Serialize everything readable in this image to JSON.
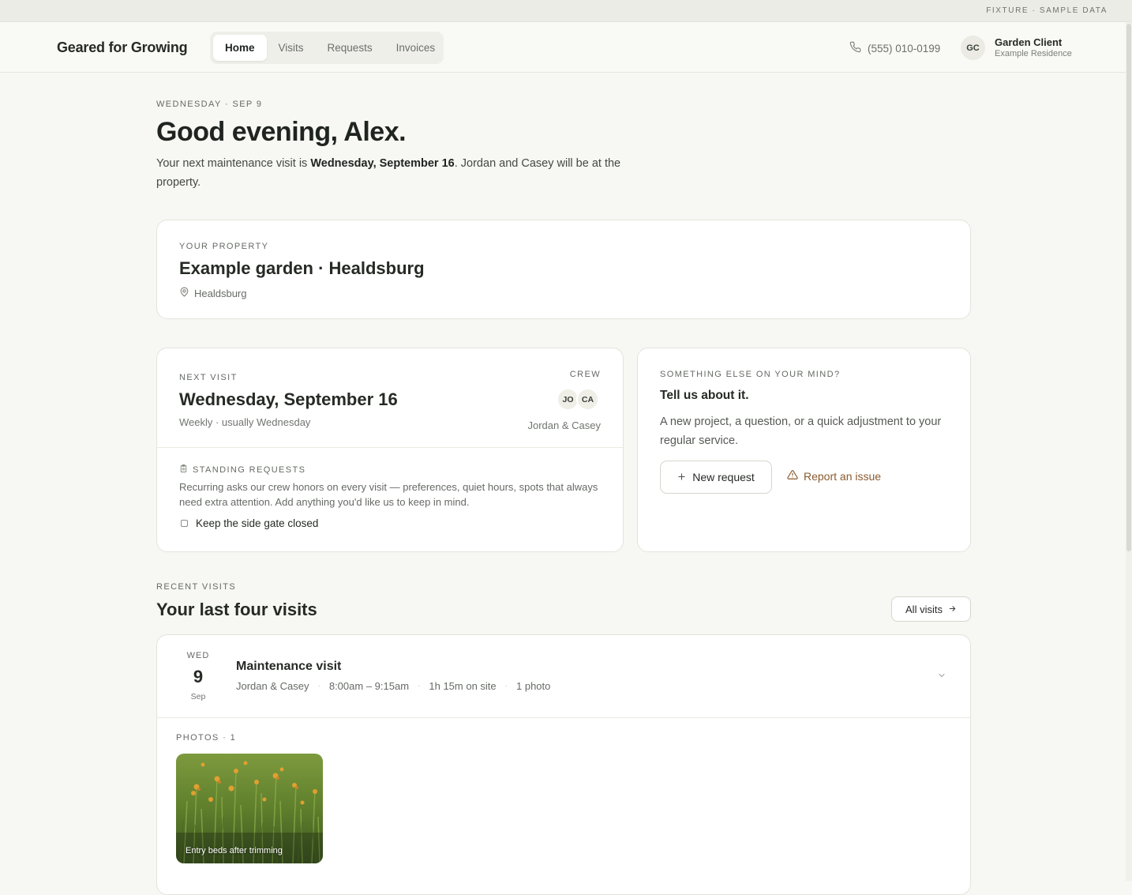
{
  "fixture_banner": "FIXTURE · SAMPLE DATA",
  "brand": "Geared for Growing",
  "nav": {
    "tabs": [
      {
        "label": "Home",
        "active": true
      },
      {
        "label": "Visits",
        "active": false
      },
      {
        "label": "Requests",
        "active": false
      },
      {
        "label": "Invoices",
        "active": false
      }
    ]
  },
  "header": {
    "phone": "(555) 010-0199",
    "phone_icon": "phone-icon",
    "avatar_initials": "GC",
    "user_name": "Garden Client",
    "user_sub": "Example Residence"
  },
  "greeting": {
    "date": "WEDNESDAY · SEP 9",
    "title": "Good evening, Alex.",
    "text_before": "Your next maintenance visit is ",
    "text_bold": "Wednesday, September 16",
    "text_after": ". Jordan and Casey will be at the property."
  },
  "property": {
    "label": "YOUR PROPERTY",
    "name": "Example garden · Healdsburg",
    "location": "Healdsburg",
    "location_icon": "map-pin-icon"
  },
  "next_visit": {
    "label": "NEXT VISIT",
    "date": "Wednesday, September 16",
    "frequency": "Weekly · usually Wednesday",
    "crew_label": "CREW",
    "crew_initials": [
      "JO",
      "CA"
    ],
    "crew_names": "Jordan & Casey",
    "standing_label": "STANDING REQUESTS",
    "standing_icon": "clipboard-icon",
    "standing_text": "Recurring asks our crew honors on every visit — preferences, quiet hours, spots that always need extra attention. Add anything you'd like us to keep in mind.",
    "standing_items": [
      "Keep the side gate closed"
    ]
  },
  "mind": {
    "label": "SOMETHING ELSE ON YOUR MIND?",
    "title": "Tell us about it.",
    "text": "A new project, a question, or a quick adjustment to your regular service.",
    "new_request": "New request",
    "report_issue": "Report an issue"
  },
  "recent": {
    "label": "RECENT VISITS",
    "title": "Your last four visits",
    "all_visits": "All visits",
    "visits": [
      {
        "dow": "WED",
        "day": "9",
        "month": "Sep",
        "title": "Maintenance visit",
        "crew": "Jordan & Casey",
        "time": "8:00am – 9:15am",
        "duration": "1h 15m on site",
        "photos_count": "1 photo",
        "photos_label": "PHOTOS · 1",
        "photo_caption": "Entry beds after trimming"
      }
    ]
  },
  "colors": {
    "accent_warning": "#8a5a2e",
    "page_bg": "#f7f7f3"
  }
}
